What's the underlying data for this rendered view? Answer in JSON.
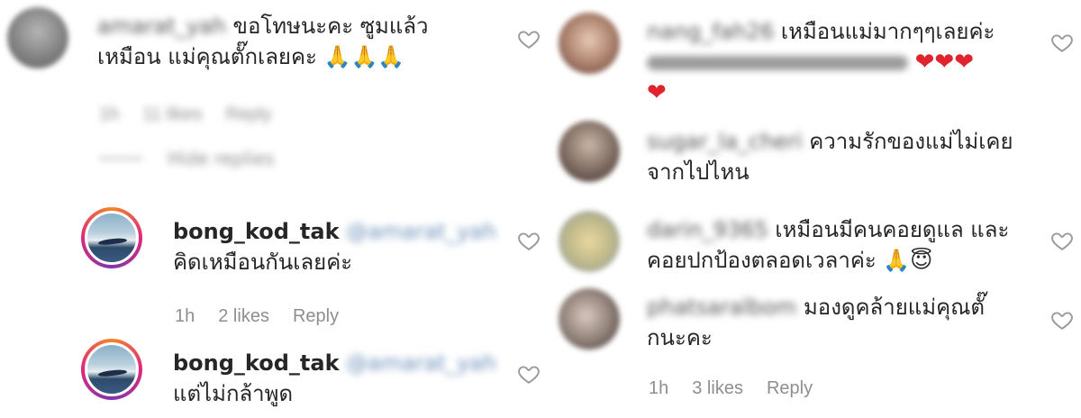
{
  "left": {
    "comment1": {
      "username": "amarat_yah",
      "text_line1": "ขอโทษนะคะ ซูมแล้ว",
      "text_line2": "เหมือน แม่คุณตั๊กเลยคะ",
      "emojis": "🙏🙏🙏",
      "time": "1h",
      "likes": "11 likes",
      "reply": "Reply",
      "hide_replies": "Hide replies"
    },
    "reply1": {
      "username": "bong_kod_tak",
      "mention": "@amarat_yah",
      "text": "คิดเหมือนกันเลยค่ะ",
      "time": "1h",
      "likes": "2 likes",
      "reply": "Reply"
    },
    "reply2": {
      "username": "bong_kod_tak",
      "mention": "@amarat_yah",
      "text": "แต่ไม่กล้าพูด"
    }
  },
  "right": {
    "comment1": {
      "username": "nang_fah26",
      "text_line1": "เหมือนแม่มากๆๆเลยค่ะ",
      "text_line2_hidden": "ต่างคนคนดูคุณตั๊กอยู่แค่",
      "hearts": "❤❤❤",
      "heart_last": "❤"
    },
    "comment2": {
      "username": "sugar_la_cheri",
      "text_line1": "ความรักของแม่ไม่เคย",
      "text_line2": "จากไปไหน"
    },
    "comment3": {
      "username": "darin_9365",
      "text_line1": "เหมือนมีคนคอยดูแล และ",
      "text_line2": "คอยปกป้องตลอดเวลาค่ะ",
      "emojis": "🙏😇"
    },
    "comment4": {
      "username": "phatsaralbom",
      "text_line1": "มองดูคล้ายแม่คุณตั๊",
      "text_line2": "กนะคะ",
      "time": "1h",
      "likes": "3 likes",
      "reply": "Reply"
    }
  },
  "icons": {
    "like": "heart-outline-icon"
  },
  "colors": {
    "meta_gray": "#8e8e8e",
    "text": "#262626",
    "heart_outline": "#9a9a9a",
    "red_heart": "#e0242e"
  }
}
